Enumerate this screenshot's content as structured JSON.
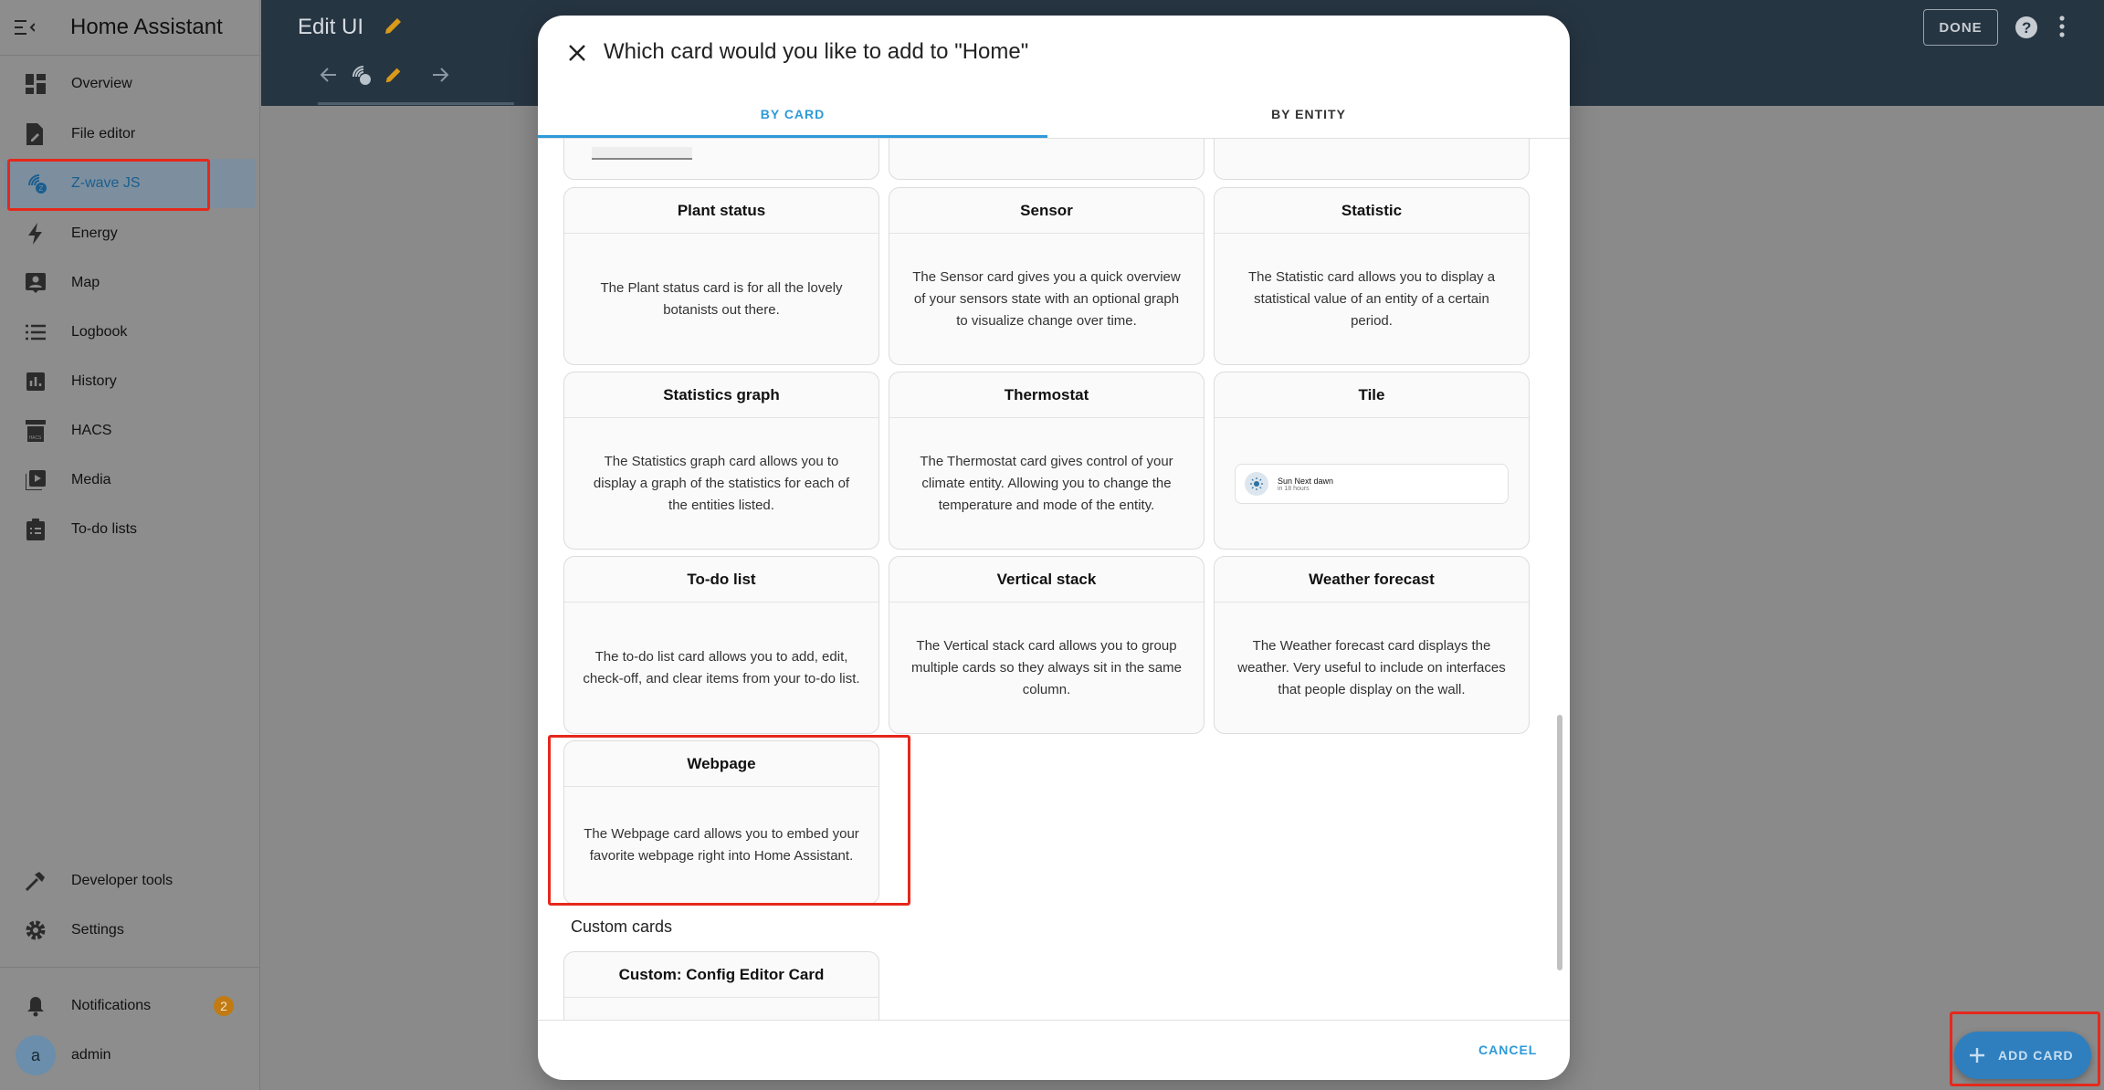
{
  "sidebar": {
    "title": "Home Assistant",
    "items": [
      {
        "label": "Overview",
        "icon": "dashboard-icon"
      },
      {
        "label": "File editor",
        "icon": "file-edit-icon"
      },
      {
        "label": "Z-wave JS",
        "icon": "zwave-icon"
      },
      {
        "label": "Energy",
        "icon": "lightning-icon"
      },
      {
        "label": "Map",
        "icon": "map-person-icon"
      },
      {
        "label": "Logbook",
        "icon": "list-icon"
      },
      {
        "label": "History",
        "icon": "chart-box-icon"
      },
      {
        "label": "HACS",
        "icon": "hacs-store-icon"
      },
      {
        "label": "Media",
        "icon": "play-box-icon"
      },
      {
        "label": "To-do lists",
        "icon": "clipboard-list-icon"
      }
    ],
    "bottom_items": [
      {
        "label": "Developer tools",
        "icon": "hammer-icon"
      },
      {
        "label": "Settings",
        "icon": "gear-icon"
      }
    ],
    "notifications": {
      "label": "Notifications",
      "count": "2"
    },
    "user": {
      "label": "admin",
      "initial": "a"
    }
  },
  "topbar": {
    "title": "Edit UI",
    "done_label": "DONE"
  },
  "dialog": {
    "title": "Which card would you like to add to \"Home\"",
    "tabs": [
      "BY CARD",
      "BY ENTITY"
    ],
    "cards": [
      {
        "title": "Plant status",
        "desc": "The Plant status card is for all the lovely botanists out there."
      },
      {
        "title": "Sensor",
        "desc": "The Sensor card gives you a quick overview of your sensors state with an optional graph to visualize change over time."
      },
      {
        "title": "Statistic",
        "desc": "The Statistic card allows you to display a statistical value of an entity of a certain period."
      },
      {
        "title": "Statistics graph",
        "desc": "The Statistics graph card allows you to display a graph of the statistics for each of the entities listed."
      },
      {
        "title": "Thermostat",
        "desc": "The Thermostat card gives control of your climate entity. Allowing you to change the temperature and mode of the entity."
      },
      {
        "title": "Tile",
        "preview_name": "Sun Next dawn",
        "preview_sub": "in 18 hours"
      },
      {
        "title": "To-do list",
        "desc": "The to-do list card allows you to add, edit, check-off, and clear items from your to-do list."
      },
      {
        "title": "Vertical stack",
        "desc": "The Vertical stack card allows you to group multiple cards so they always sit in the same column."
      },
      {
        "title": "Weather forecast",
        "desc": "The Weather forecast card displays the weather. Very useful to include on interfaces that people display on the wall."
      },
      {
        "title": "Webpage",
        "desc": "The Webpage card allows you to embed your favorite webpage right into Home Assistant."
      }
    ],
    "custom_section_label": "Custom cards",
    "custom_cards": [
      {
        "title": "Custom: Config Editor Card"
      }
    ],
    "cancel_label": "CANCEL"
  },
  "fab": {
    "label": "ADD CARD"
  },
  "colors": {
    "accent": "#2d9ad9",
    "highlight": "#e5281c",
    "topbar": "#263542",
    "badge": "#c27a12"
  }
}
